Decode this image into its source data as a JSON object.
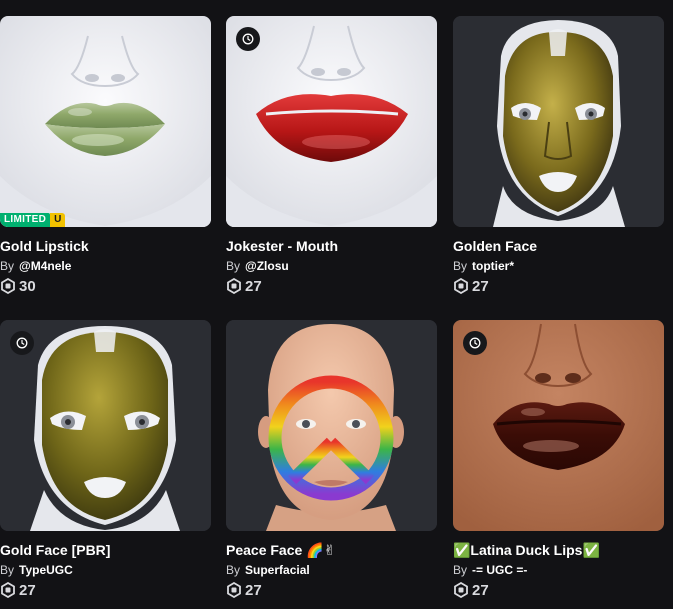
{
  "items": [
    {
      "name": "Gold Lipstick",
      "by": "By",
      "creator": "@M4nele",
      "price": "30",
      "badge": {
        "limited": "LIMITED",
        "u": "U"
      },
      "clock": false
    },
    {
      "name": "Jokester - Mouth",
      "by": "By",
      "creator": "@Zlosu",
      "price": "27",
      "clock": true
    },
    {
      "name": "Golden Face",
      "by": "By",
      "creator": "toptier*",
      "price": "27",
      "clock": false
    },
    {
      "name": "Gold Face [PBR]",
      "by": "By",
      "creator": "TypeUGC",
      "price": "27",
      "clock": true
    },
    {
      "name": "Peace Face 🌈✌",
      "by": "By",
      "creator": "Superfacial",
      "price": "27",
      "clock": false
    },
    {
      "name": "✅Latina Duck Lips✅",
      "by": "By",
      "creator": "-= UGC =-",
      "price": "27",
      "clock": true
    }
  ],
  "colors": {
    "background": "#121215",
    "card": "#2b2d33",
    "limited": "#00b06f",
    "unique": "#f2c200"
  },
  "icons": {
    "clock": "clock-icon",
    "robux": "robux-icon"
  }
}
